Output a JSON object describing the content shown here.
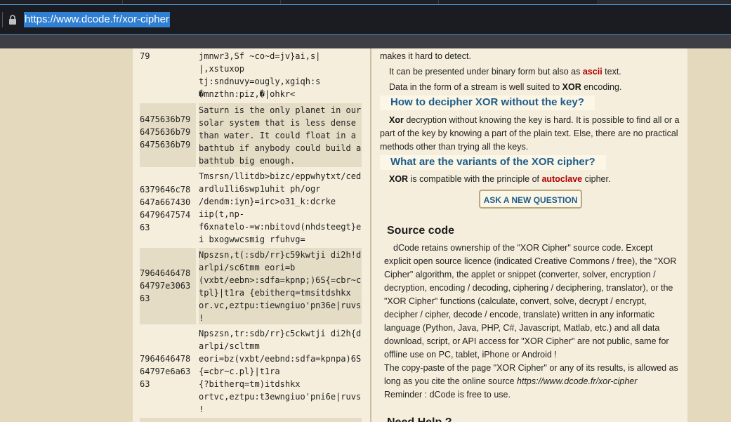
{
  "browser": {
    "url": "https://www.dcode.fr/xor-cipher"
  },
  "table": {
    "rows": [
      {
        "hex": "79",
        "text": "jmnwr3,Sf ~co~d=jv}ai,s|\n|,xstuxop\ntj:sndnuvy=ougly,xgiqh:s\n�mnzthn:piz,�|ohkr<"
      },
      {
        "hex": "6475636b79\n6475636b79\n6475636b79",
        "text": "Saturn is the only planet in our\nsolar system that is less dense\nthan water. It could float in a\nbathtub if anybody could build a\nbathtub big enough."
      },
      {
        "hex": "6379646c78\n647a667430\n6479647574\n63",
        "text": "Tmsrsn/llitdb>bizc/eppwhytxt/ced\nardlu1li6swp1uhit ph/ogr\n/dendm:iyn}=irc>o31_k:dcrke\niip(t,np-\nf6xnatelo-=w:nbitovd(nhdsteegt}e\ni bxogwwcsmig rfuhvg="
      },
      {
        "hex": "7964646478\n64797e3063\n63",
        "text": "Npszsn,t(:sdb/rr}c59kwtji di2h!d\narlpi/sc6tmm eori=b\n(vxbt/eebn>:sdfa=kpnp;)6S{=cbr~c\ntpl}|t1ra {ebitherq=tmsitdshkx\nor.vc,eztpu:tiewngiuo'pn36e|ruvs\n!"
      },
      {
        "hex": "7964646478\n64797e6a63\n63",
        "text": "Npszsn,tr:sdb/rr}c5ckwtji di2h{d\narlpi/scltmm\neori=bz(vxbt/eebnd:sdfa=kpnpa)6S\n{=cbr~c.pl}|t1ra\n{?bitherq=tm)itdshkx\nortvc,eztpu:t3ewngiuo'pni6e|ruvs\n!"
      }
    ]
  },
  "article": {
    "p1": "makes it hard to detect.",
    "p2_a": "It can be presented under binary form but also as ",
    "p2_link": "ascii",
    "p2_b": " text.",
    "p3_a": "Data in the form of a stream is well suited to ",
    "p3_bold": "XOR",
    "p3_b": " encoding.",
    "h_decipher": "How to decipher XOR without the key?",
    "p4_bold": "Xor",
    "p4_rest": " decryption without knowing the key is hard. It is possible to find all or a part of the key by knowing a part of the plain text. Else, there are no practical methods other than trying all the keys.",
    "h_variants": "What are the variants of the XOR cipher?",
    "p5_bold": "XOR",
    "p5_a": " is compatible with the principle of ",
    "p5_link": "autoclave",
    "p5_b": " cipher.",
    "ask_button": "ASK A NEW QUESTION",
    "source_title": "Source code",
    "source_text": "dCode retains ownership of the \"XOR Cipher\" source code. Except explicit open source licence (indicated Creative Commons / free), the \"XOR Cipher\" algorithm, the applet or snippet (converter, solver, encryption / decryption, encoding / decoding, ciphering / deciphering, translator), or the \"XOR Cipher\" functions (calculate, convert, solve, decrypt / encrypt, decipher / cipher, decode / encode, translate) written in any informatic language (Python, Java, PHP, C#, Javascript, Matlab, etc.) and all data download, script, or API access for \"XOR Cipher\" are not public, same for offline use on PC, tablet, iPhone or Android !",
    "copy_text_a": "The copy-paste of the page \"XOR Cipher\" or any of its results, is allowed as long as you cite the online source ",
    "copy_url": "https://www.dcode.fr/xor-cipher",
    "reminder": "Reminder : dCode is free to use.",
    "need_help": "Need Help ?"
  }
}
